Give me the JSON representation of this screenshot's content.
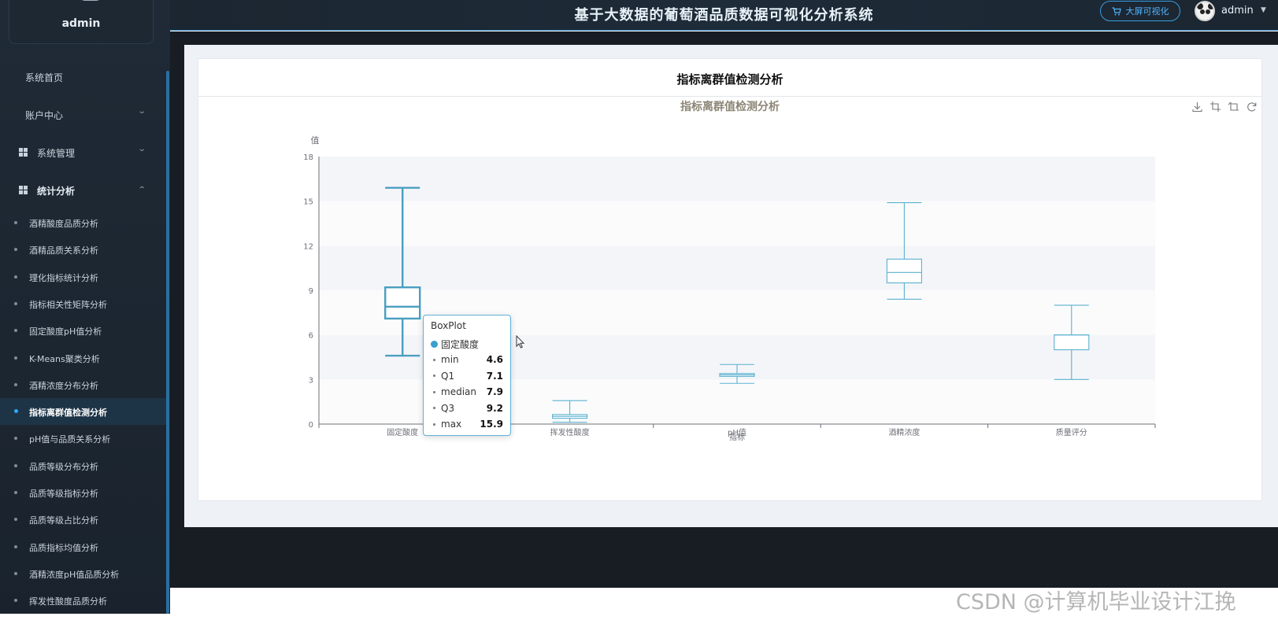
{
  "app": {
    "title": "基于大数据的葡萄酒品质数据可视化分析系统",
    "bigscreen_label": "大屏可视化",
    "username": "admin"
  },
  "sidebar": {
    "user_name": "admin",
    "top_items": [
      {
        "label": "系统首页"
      },
      {
        "label": "账户中心"
      },
      {
        "label": "系统管理"
      },
      {
        "label": "统计分析"
      }
    ],
    "sub_items": [
      {
        "label": "酒精酸度品质分析"
      },
      {
        "label": "酒精品质关系分析"
      },
      {
        "label": "理化指标统计分析"
      },
      {
        "label": "指标相关性矩阵分析"
      },
      {
        "label": "固定酸度pH值分析"
      },
      {
        "label": "K-Means聚类分析"
      },
      {
        "label": "酒精浓度分布分析"
      },
      {
        "label": "指标离群值检测分析"
      },
      {
        "label": "pH值与品质关系分析"
      },
      {
        "label": "品质等级分布分析"
      },
      {
        "label": "品质等级指标分析"
      },
      {
        "label": "品质等级占比分析"
      },
      {
        "label": "品质指标均值分析"
      },
      {
        "label": "酒精浓度pH值品质分析"
      },
      {
        "label": "挥发性酸度品质分析"
      }
    ],
    "active_sub_index": 7
  },
  "card": {
    "title": "指标离群值检测分析"
  },
  "chart_data": {
    "type": "boxplot",
    "title": "指标离群值检测分析",
    "ylabel": "值",
    "xlabel": "指标",
    "ylim": [
      0,
      18
    ],
    "yticks": [
      0,
      3,
      6,
      9,
      12,
      15,
      18
    ],
    "categories": [
      "固定酸度",
      "挥发性酸度",
      "pH值",
      "酒精浓度",
      "质量评分"
    ],
    "series": [
      {
        "boxes": [
          {
            "min": 4.6,
            "q1": 7.1,
            "median": 7.9,
            "q3": 9.2,
            "max": 15.9
          },
          {
            "min": 0.12,
            "q1": 0.39,
            "median": 0.52,
            "q3": 0.64,
            "max": 1.58
          },
          {
            "min": 2.74,
            "q1": 3.21,
            "median": 3.31,
            "q3": 3.4,
            "max": 4.01
          },
          {
            "min": 8.4,
            "q1": 9.5,
            "median": 10.2,
            "q3": 11.1,
            "max": 14.9
          },
          {
            "min": 3,
            "q1": 5,
            "median": 6,
            "q3": 6,
            "max": 8
          }
        ]
      }
    ],
    "box_color": "#5ab1d0",
    "highlight_index": 0,
    "grid": "alternating bands"
  },
  "tooltip": {
    "title": "BoxPlot",
    "series_name": "固定酸度",
    "rows": [
      {
        "key": "min",
        "value": "4.6"
      },
      {
        "key": "Q1",
        "value": "7.1"
      },
      {
        "key": "median",
        "value": "7.9"
      },
      {
        "key": "Q3",
        "value": "9.2"
      },
      {
        "key": "max",
        "value": "15.9"
      }
    ]
  },
  "toolbox": [
    "download-icon",
    "zoom-icon",
    "zoom-reset-icon",
    "restore-icon"
  ],
  "watermark": "CSDN @计算机毕业设计江挽"
}
